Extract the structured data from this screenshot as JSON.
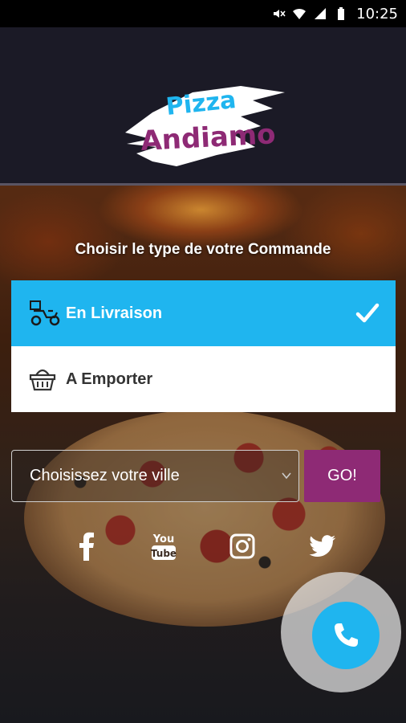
{
  "status_bar": {
    "time": "10:25",
    "icons": [
      "mute-icon",
      "wifi-icon",
      "signal-icon",
      "battery-icon"
    ]
  },
  "header": {
    "logo_line1": "Pizza",
    "logo_line2": "Andiamo"
  },
  "order": {
    "title": "Choisir le type de votre Commande",
    "options": [
      {
        "label": "En Livraison",
        "icon": "scooter-icon",
        "selected": true
      },
      {
        "label": "A Emporter",
        "icon": "basket-icon",
        "selected": false
      }
    ]
  },
  "city": {
    "placeholder": "Choisissez votre ville",
    "go_label": "GO!"
  },
  "social": [
    "facebook-icon",
    "youtube-icon",
    "instagram-icon",
    "twitter-icon"
  ],
  "colors": {
    "accent": "#1fb5ef",
    "brand": "#8e2a75",
    "header_bg": "#1b1a26"
  }
}
